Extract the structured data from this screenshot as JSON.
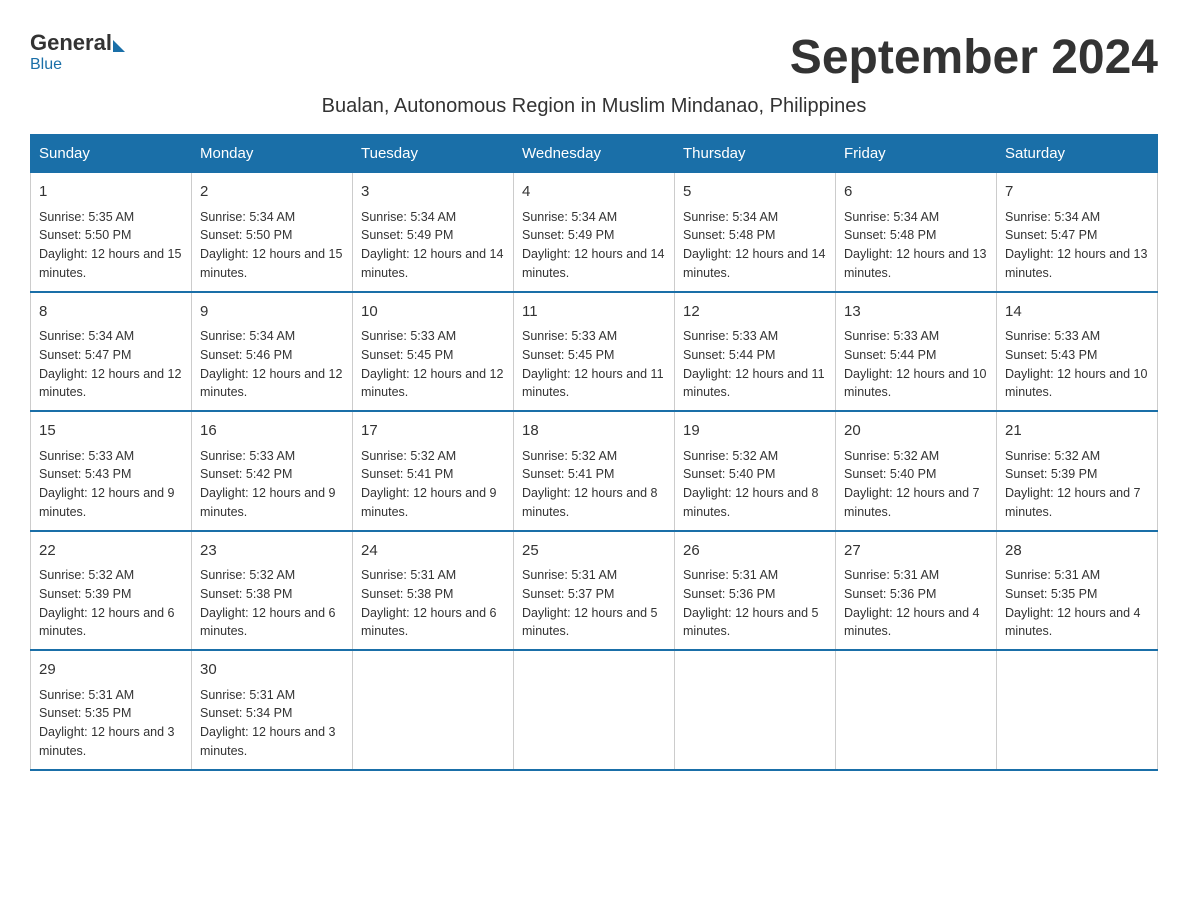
{
  "logo": {
    "general": "General",
    "blue": "Blue"
  },
  "title": "September 2024",
  "subtitle": "Bualan, Autonomous Region in Muslim Mindanao, Philippines",
  "days_of_week": [
    "Sunday",
    "Monday",
    "Tuesday",
    "Wednesday",
    "Thursday",
    "Friday",
    "Saturday"
  ],
  "weeks": [
    [
      {
        "day": "1",
        "sunrise": "Sunrise: 5:35 AM",
        "sunset": "Sunset: 5:50 PM",
        "daylight": "Daylight: 12 hours and 15 minutes."
      },
      {
        "day": "2",
        "sunrise": "Sunrise: 5:34 AM",
        "sunset": "Sunset: 5:50 PM",
        "daylight": "Daylight: 12 hours and 15 minutes."
      },
      {
        "day": "3",
        "sunrise": "Sunrise: 5:34 AM",
        "sunset": "Sunset: 5:49 PM",
        "daylight": "Daylight: 12 hours and 14 minutes."
      },
      {
        "day": "4",
        "sunrise": "Sunrise: 5:34 AM",
        "sunset": "Sunset: 5:49 PM",
        "daylight": "Daylight: 12 hours and 14 minutes."
      },
      {
        "day": "5",
        "sunrise": "Sunrise: 5:34 AM",
        "sunset": "Sunset: 5:48 PM",
        "daylight": "Daylight: 12 hours and 14 minutes."
      },
      {
        "day": "6",
        "sunrise": "Sunrise: 5:34 AM",
        "sunset": "Sunset: 5:48 PM",
        "daylight": "Daylight: 12 hours and 13 minutes."
      },
      {
        "day": "7",
        "sunrise": "Sunrise: 5:34 AM",
        "sunset": "Sunset: 5:47 PM",
        "daylight": "Daylight: 12 hours and 13 minutes."
      }
    ],
    [
      {
        "day": "8",
        "sunrise": "Sunrise: 5:34 AM",
        "sunset": "Sunset: 5:47 PM",
        "daylight": "Daylight: 12 hours and 12 minutes."
      },
      {
        "day": "9",
        "sunrise": "Sunrise: 5:34 AM",
        "sunset": "Sunset: 5:46 PM",
        "daylight": "Daylight: 12 hours and 12 minutes."
      },
      {
        "day": "10",
        "sunrise": "Sunrise: 5:33 AM",
        "sunset": "Sunset: 5:45 PM",
        "daylight": "Daylight: 12 hours and 12 minutes."
      },
      {
        "day": "11",
        "sunrise": "Sunrise: 5:33 AM",
        "sunset": "Sunset: 5:45 PM",
        "daylight": "Daylight: 12 hours and 11 minutes."
      },
      {
        "day": "12",
        "sunrise": "Sunrise: 5:33 AM",
        "sunset": "Sunset: 5:44 PM",
        "daylight": "Daylight: 12 hours and 11 minutes."
      },
      {
        "day": "13",
        "sunrise": "Sunrise: 5:33 AM",
        "sunset": "Sunset: 5:44 PM",
        "daylight": "Daylight: 12 hours and 10 minutes."
      },
      {
        "day": "14",
        "sunrise": "Sunrise: 5:33 AM",
        "sunset": "Sunset: 5:43 PM",
        "daylight": "Daylight: 12 hours and 10 minutes."
      }
    ],
    [
      {
        "day": "15",
        "sunrise": "Sunrise: 5:33 AM",
        "sunset": "Sunset: 5:43 PM",
        "daylight": "Daylight: 12 hours and 9 minutes."
      },
      {
        "day": "16",
        "sunrise": "Sunrise: 5:33 AM",
        "sunset": "Sunset: 5:42 PM",
        "daylight": "Daylight: 12 hours and 9 minutes."
      },
      {
        "day": "17",
        "sunrise": "Sunrise: 5:32 AM",
        "sunset": "Sunset: 5:41 PM",
        "daylight": "Daylight: 12 hours and 9 minutes."
      },
      {
        "day": "18",
        "sunrise": "Sunrise: 5:32 AM",
        "sunset": "Sunset: 5:41 PM",
        "daylight": "Daylight: 12 hours and 8 minutes."
      },
      {
        "day": "19",
        "sunrise": "Sunrise: 5:32 AM",
        "sunset": "Sunset: 5:40 PM",
        "daylight": "Daylight: 12 hours and 8 minutes."
      },
      {
        "day": "20",
        "sunrise": "Sunrise: 5:32 AM",
        "sunset": "Sunset: 5:40 PM",
        "daylight": "Daylight: 12 hours and 7 minutes."
      },
      {
        "day": "21",
        "sunrise": "Sunrise: 5:32 AM",
        "sunset": "Sunset: 5:39 PM",
        "daylight": "Daylight: 12 hours and 7 minutes."
      }
    ],
    [
      {
        "day": "22",
        "sunrise": "Sunrise: 5:32 AM",
        "sunset": "Sunset: 5:39 PM",
        "daylight": "Daylight: 12 hours and 6 minutes."
      },
      {
        "day": "23",
        "sunrise": "Sunrise: 5:32 AM",
        "sunset": "Sunset: 5:38 PM",
        "daylight": "Daylight: 12 hours and 6 minutes."
      },
      {
        "day": "24",
        "sunrise": "Sunrise: 5:31 AM",
        "sunset": "Sunset: 5:38 PM",
        "daylight": "Daylight: 12 hours and 6 minutes."
      },
      {
        "day": "25",
        "sunrise": "Sunrise: 5:31 AM",
        "sunset": "Sunset: 5:37 PM",
        "daylight": "Daylight: 12 hours and 5 minutes."
      },
      {
        "day": "26",
        "sunrise": "Sunrise: 5:31 AM",
        "sunset": "Sunset: 5:36 PM",
        "daylight": "Daylight: 12 hours and 5 minutes."
      },
      {
        "day": "27",
        "sunrise": "Sunrise: 5:31 AM",
        "sunset": "Sunset: 5:36 PM",
        "daylight": "Daylight: 12 hours and 4 minutes."
      },
      {
        "day": "28",
        "sunrise": "Sunrise: 5:31 AM",
        "sunset": "Sunset: 5:35 PM",
        "daylight": "Daylight: 12 hours and 4 minutes."
      }
    ],
    [
      {
        "day": "29",
        "sunrise": "Sunrise: 5:31 AM",
        "sunset": "Sunset: 5:35 PM",
        "daylight": "Daylight: 12 hours and 3 minutes."
      },
      {
        "day": "30",
        "sunrise": "Sunrise: 5:31 AM",
        "sunset": "Sunset: 5:34 PM",
        "daylight": "Daylight: 12 hours and 3 minutes."
      },
      null,
      null,
      null,
      null,
      null
    ]
  ]
}
